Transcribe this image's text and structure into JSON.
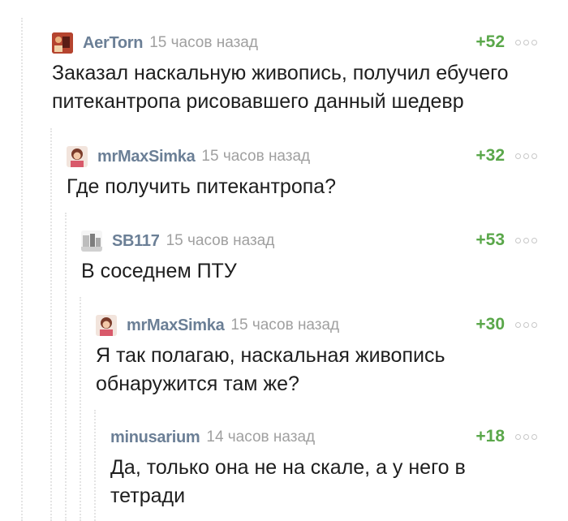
{
  "comments": [
    {
      "username": "AerTorn",
      "time": "15 часов назад",
      "rating": "+52",
      "text": "Заказал наскальную живопись, получил ебучего питекантропа рисовавшего данный шедевр",
      "avatar": "avatar-aertorn"
    },
    {
      "username": "mrMaxSimka",
      "time": "15 часов назад",
      "rating": "+32",
      "text": "Где получить питекантропа?",
      "avatar": "avatar-mrmaxsimka"
    },
    {
      "username": "SB117",
      "time": "15 часов назад",
      "rating": "+53",
      "text": "В соседнем ПТУ",
      "avatar": "avatar-sb117"
    },
    {
      "username": "mrMaxSimka",
      "time": "15 часов назад",
      "rating": "+30",
      "text": "Я так полагаю, наскальная живопись обнаружится там же?",
      "avatar": "avatar-mrmaxsimka"
    },
    {
      "username": "minusarium",
      "time": "14 часов назад",
      "rating": "+18",
      "text": "Да, только она не на скале, а у него в тетради",
      "avatar": ""
    }
  ],
  "colors": {
    "username": "#6b7f96",
    "rating_positive": "#5aa74a",
    "time": "#a0a0a0",
    "thread_line": "#e4e4e4"
  }
}
